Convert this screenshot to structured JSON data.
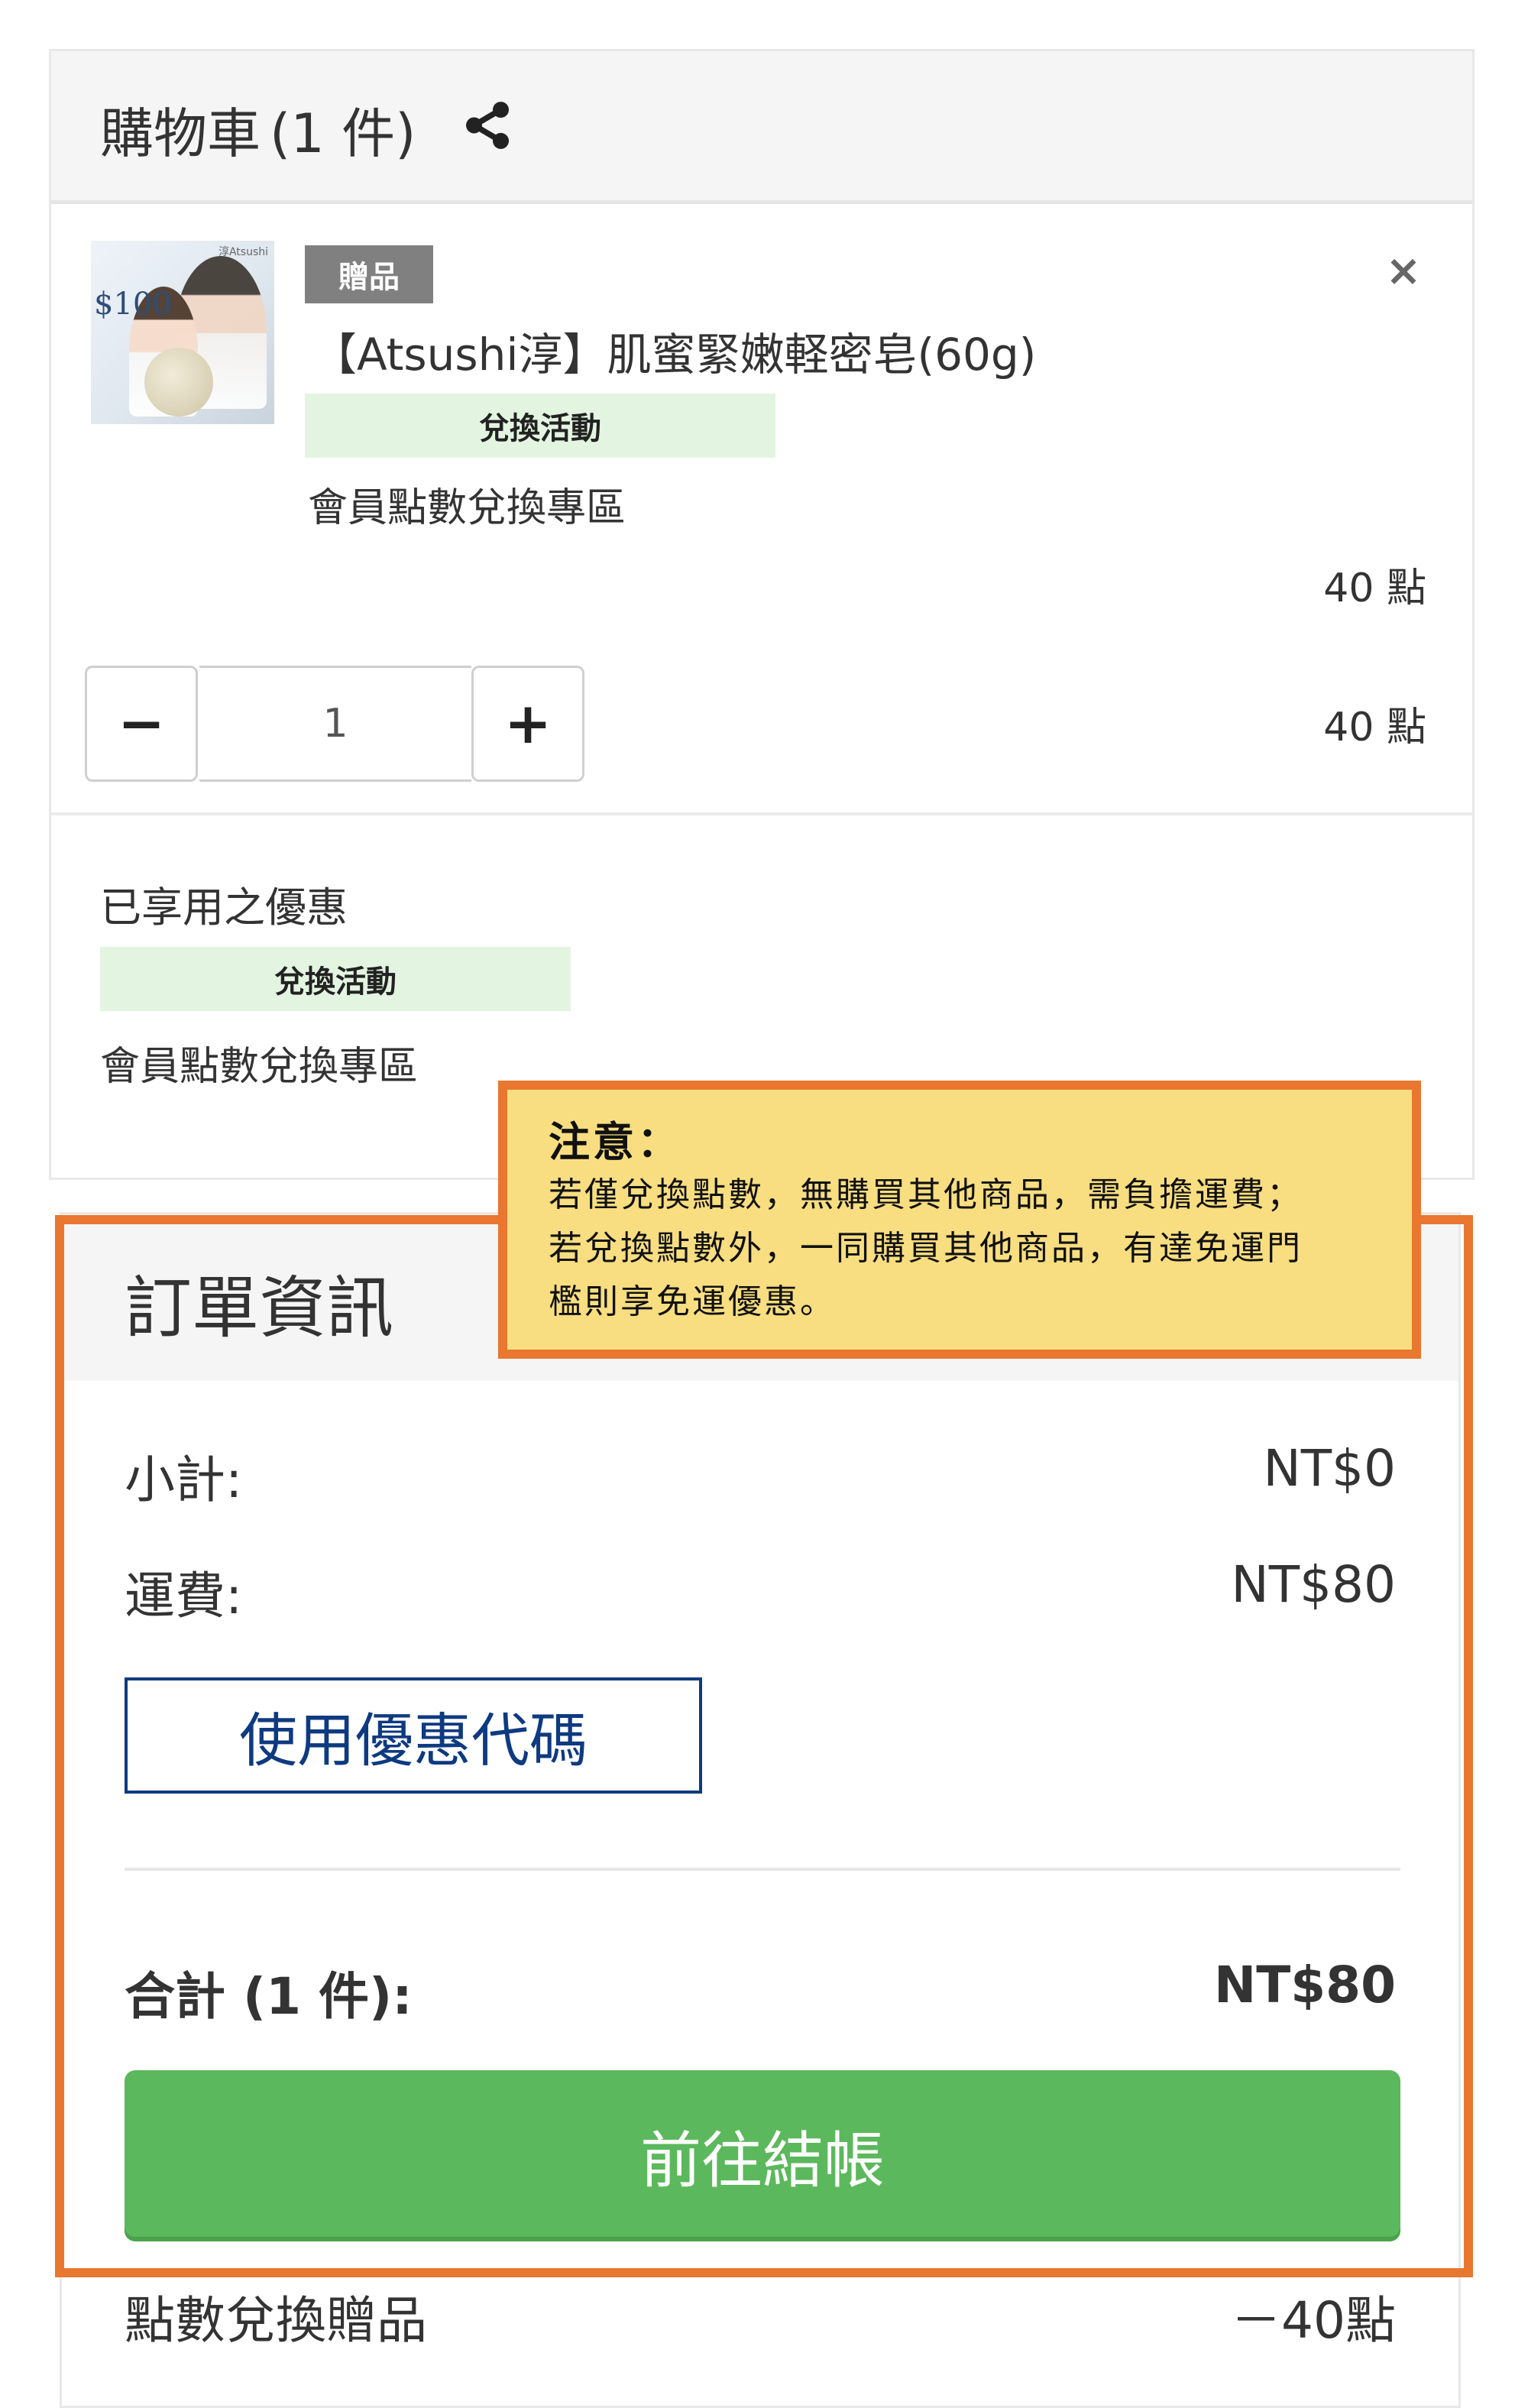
{
  "cart": {
    "title": "購物車",
    "count_text": "(1 件)",
    "item": {
      "thumb_brand": "淳Atsushi",
      "thumb_price": "$100",
      "badge": "贈品",
      "name": "【Atsushi淳】肌蜜緊嫩軽密皂(60g)",
      "promo_badge": "兌換活動",
      "zone": "會員點數兌換專區",
      "unit_points": "40 點",
      "quantity": "1",
      "line_points": "40 點",
      "minus_label": "−",
      "plus_label": "+",
      "remove_label": "×"
    },
    "applied": {
      "title": "已享用之優惠",
      "promo_badge": "兌換活動",
      "zone": "會員點數兌換專區"
    }
  },
  "order": {
    "title": "訂單資訊",
    "subtotal_label": "小計:",
    "subtotal_value": "NT$0",
    "shipping_label": "運費:",
    "shipping_value": "NT$80",
    "coupon_button": "使用優惠代碼",
    "total_label": "合計 (1 件):",
    "total_value": "NT$80",
    "checkout_button": "前往結帳",
    "redeem_label": "點數兌換贈品",
    "redeem_value": "－40點"
  },
  "notice": {
    "title": "注意：",
    "lines": [
      "若僅兌換點數，無購買其他商品，需負擔運費；",
      "若兌換點數外，一同購買其他商品，有達免運門",
      "檻則享免運優惠。"
    ]
  },
  "colors": {
    "accent_orange": "#e9772f",
    "notice_yellow": "#f8de80",
    "checkout_green": "#5cb85c",
    "coupon_blue": "#0e3a80",
    "promo_green_bg": "#e3f5e1"
  },
  "icons": [
    "share-icon",
    "close-icon",
    "minus-icon",
    "plus-icon"
  ]
}
